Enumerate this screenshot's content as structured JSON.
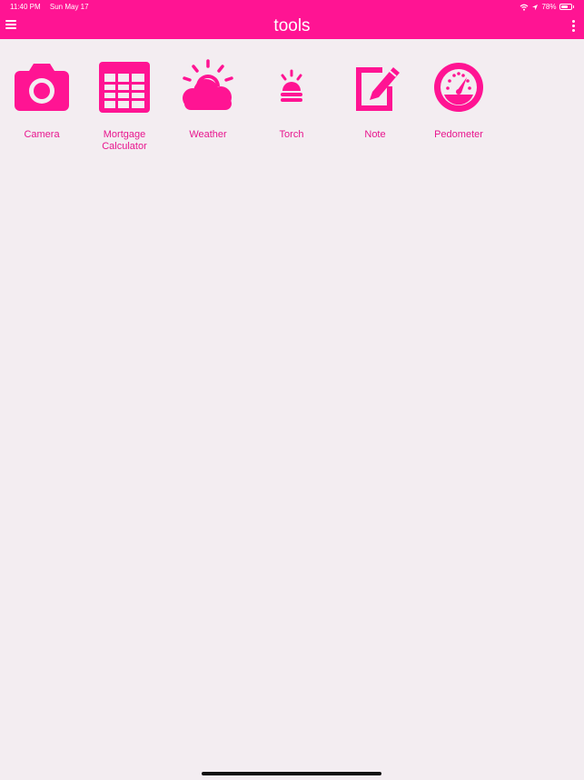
{
  "colors": {
    "accent": "#ff1493",
    "background": "#f3edf1",
    "label": "#e8168e"
  },
  "status_bar": {
    "time": "11:40 PM",
    "date": "Sun May 17",
    "battery": "78%",
    "battery_level": 0.78,
    "icons": [
      "wifi-icon",
      "location-icon",
      "battery-icon"
    ]
  },
  "app_bar": {
    "title": "tools",
    "left_icon": "menu-icon",
    "right_icon": "more-vertical-icon"
  },
  "tools": [
    {
      "label": "Camera",
      "icon": "camera-icon"
    },
    {
      "label": "Mortgage\nCalculator",
      "icon": "calculator-grid-icon"
    },
    {
      "label": "Weather",
      "icon": "weather-icon"
    },
    {
      "label": "Torch",
      "icon": "torch-icon"
    },
    {
      "label": "Note",
      "icon": "note-icon"
    },
    {
      "label": "Pedometer",
      "icon": "pedometer-icon"
    }
  ]
}
